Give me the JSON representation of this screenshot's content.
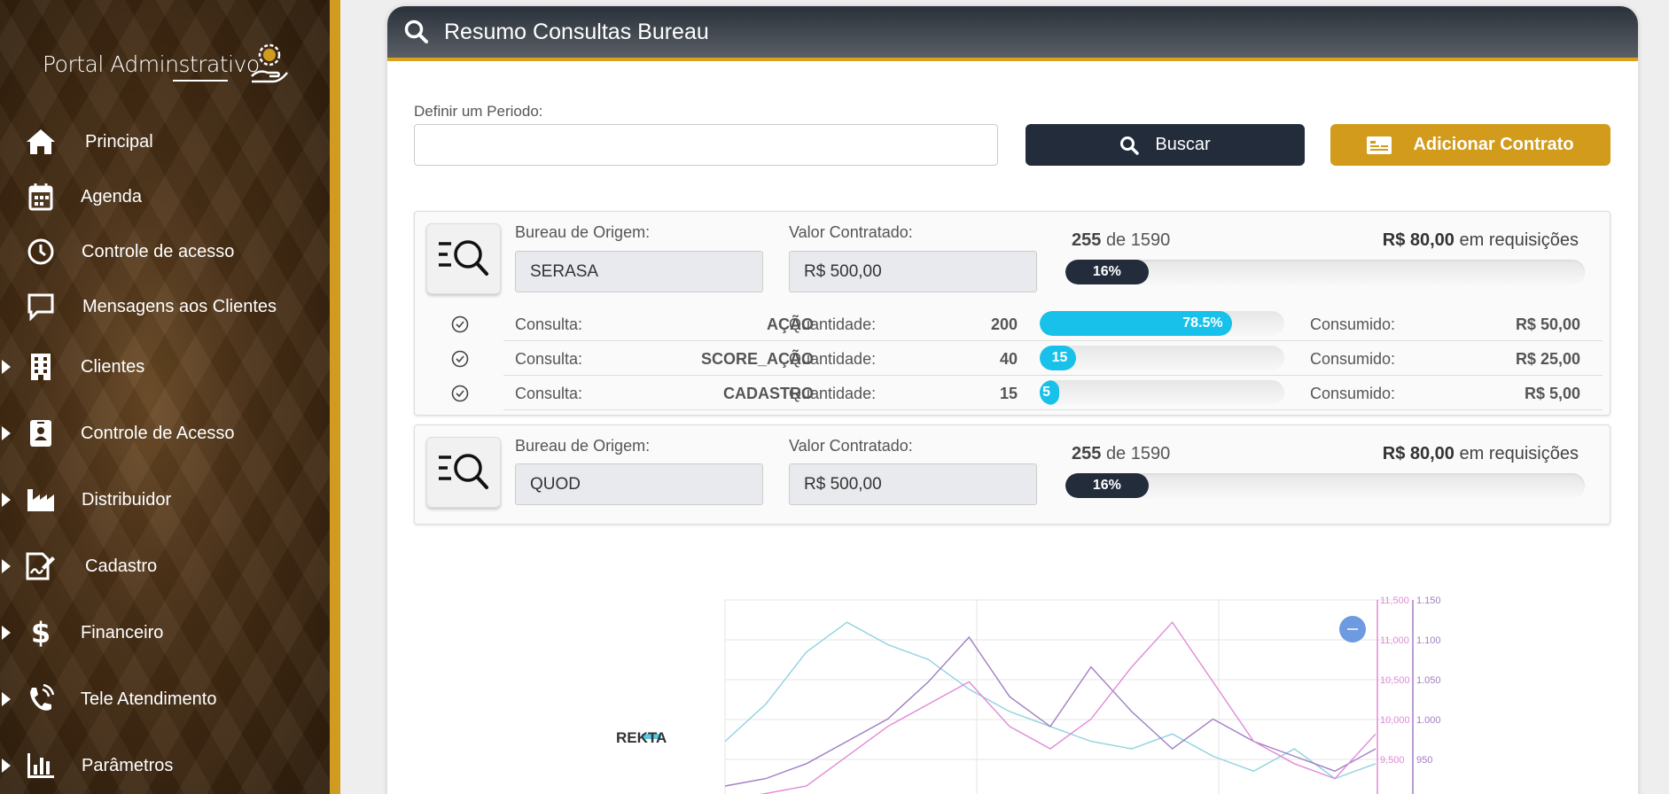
{
  "sidebar": {
    "brand": "Portal Adminstrativo",
    "items": [
      {
        "label": "Principal",
        "icon": "home-icon",
        "expandable": false
      },
      {
        "label": "Agenda",
        "icon": "calendar-icon",
        "expandable": false
      },
      {
        "label": "Controle de acesso",
        "icon": "clock-icon",
        "expandable": false
      },
      {
        "label": "Mensagens aos Clientes",
        "icon": "chat-icon",
        "expandable": false
      },
      {
        "label": "Clientes",
        "icon": "building-icon",
        "expandable": true
      },
      {
        "label": "Controle de Acesso",
        "icon": "id-badge-icon",
        "expandable": true
      },
      {
        "label": "Distribuidor",
        "icon": "factory-icon",
        "expandable": true
      },
      {
        "label": "Cadastro",
        "icon": "signature-icon",
        "expandable": true
      },
      {
        "label": "Financeiro",
        "icon": "dollar-icon",
        "expandable": true
      },
      {
        "label": "Tele Atendimento",
        "icon": "phone-volume-icon",
        "expandable": true
      },
      {
        "label": "Parâmetros",
        "icon": "bar-chart-icon",
        "expandable": true
      }
    ]
  },
  "header": {
    "title": "Resumo Consultas Bureau"
  },
  "form": {
    "period_label": "Definir um Periodo:",
    "period_value": "",
    "search_label": "Buscar",
    "add_contract_label": "Adicionar Contrato"
  },
  "bureaus": [
    {
      "origin_label": "Bureau de Origem:",
      "origin": "SERASA",
      "value_label": "Valor Contratado:",
      "value": "R$ 500,00",
      "used": "255",
      "of_text": "de 1590",
      "req_value": "R$ 80,00",
      "req_text": "em requisições",
      "progress": 16,
      "progress_label": "16%",
      "consultas": [
        {
          "consulta_label": "Consulta:",
          "name": "AÇÃO",
          "qty_label": "Quantidade:",
          "qty": "200",
          "pct": 78.5,
          "pct_label": "78.5%",
          "consumed_label": "Consumido:",
          "consumed": "R$ 50,00"
        },
        {
          "consulta_label": "Consulta:",
          "name": "SCORE_AÇÃO",
          "qty_label": "Quantidade:",
          "qty": "40",
          "pct": 15,
          "pct_label": "15",
          "consumed_label": "Consumido:",
          "consumed": "R$ 25,00"
        },
        {
          "consulta_label": "Consulta:",
          "name": "CADASTRO",
          "qty_label": "Quantidade:",
          "qty": "15",
          "pct": 5,
          "pct_label": "5",
          "consumed_label": "Consumido:",
          "consumed": "R$ 5,00"
        }
      ]
    },
    {
      "origin_label": "Bureau de Origem:",
      "origin": "QUOD",
      "value_label": "Valor Contratado:",
      "value": "R$ 500,00",
      "used": "255",
      "of_text": "de 1590",
      "req_value": "R$ 80,00",
      "req_text": "em requisições",
      "progress": 16,
      "progress_label": "16%"
    }
  ],
  "chart_data": {
    "type": "line",
    "legend_label": "REKTA",
    "y_right_1_ticks": [
      "11,500",
      "11,000",
      "10,500",
      "10,000",
      "9,500"
    ],
    "y_right_2_ticks": [
      "1.150",
      "1.100",
      "1.050",
      "1.000",
      "950"
    ],
    "series": [
      {
        "color": "#8fd3e0",
        "values": [
          9.6,
          10.1,
          10.8,
          11.2,
          10.9,
          10.7,
          10.3,
          10.0,
          9.8,
          9.6,
          9.5,
          9.7,
          9.4,
          9.2,
          9.5,
          9.1,
          9.3
        ]
      },
      {
        "color": "#a07ec4",
        "values": [
          9.0,
          9.1,
          9.3,
          9.6,
          9.9,
          10.4,
          11.0,
          10.2,
          9.8,
          10.6,
          10.0,
          9.5,
          9.9,
          9.6,
          9.4,
          9.2,
          9.5
        ]
      },
      {
        "color": "#e08ad8",
        "values": [
          8.8,
          8.9,
          9.0,
          9.4,
          9.8,
          10.1,
          10.4,
          9.8,
          9.5,
          9.9,
          10.6,
          11.2,
          10.4,
          9.6,
          9.3,
          9.1,
          9.7
        ]
      }
    ],
    "colors": {
      "accent": "#d19b1f",
      "dark": "#222c3b",
      "cyan": "#17c1ea"
    }
  }
}
